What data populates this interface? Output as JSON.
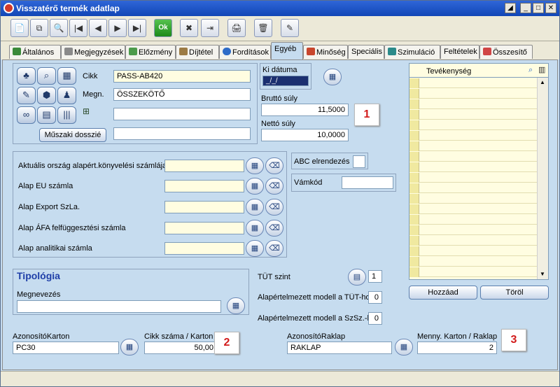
{
  "window": {
    "title": "Visszatérő termék adatlap",
    "controls": {
      "menu": "◢",
      "minimize": "_",
      "maximize": "□",
      "close": "✕"
    }
  },
  "toolbar": [
    {
      "icon": "new-icon",
      "glyph": "📄"
    },
    {
      "icon": "copy-icon",
      "glyph": "⧉"
    },
    {
      "icon": "search-icon",
      "glyph": "🔍"
    },
    {
      "icon": "first-icon",
      "glyph": "|◀"
    },
    {
      "icon": "prev-icon",
      "glyph": "◀"
    },
    {
      "icon": "next-icon",
      "glyph": "▶"
    },
    {
      "icon": "last-icon",
      "glyph": "▶|"
    },
    {
      "icon": "ok-icon",
      "glyph": "Ok"
    },
    {
      "icon": "delete-icon",
      "glyph": "✖"
    },
    {
      "icon": "exit-icon",
      "glyph": "⇥"
    },
    {
      "icon": "print-icon",
      "glyph": "🖨"
    },
    {
      "icon": "trash-icon",
      "glyph": "🗑"
    },
    {
      "icon": "tools-icon",
      "glyph": "✎"
    }
  ],
  "tabs": [
    "Általános",
    "Megjegyzések",
    "Előzmény",
    "Díjtétel",
    "Fordítások",
    "Egyéb",
    "Minőség",
    "Speciális",
    "Szimuláció",
    "Feltételek",
    "Összesítő"
  ],
  "active_tab": "Egyéb",
  "product": {
    "cikk_label": "Cikk",
    "cikk_value": "PASS-AB420",
    "megn_label": "Megn.",
    "megn_value": "ÖSSZEKÖTŐ",
    "field3_value": "",
    "field4_value": "",
    "dossier_button": "Műszaki dosszié"
  },
  "ki_datuma": {
    "label": "Ki dátuma",
    "value": "_/_/"
  },
  "weights": {
    "brutto_label": "Bruttó súly",
    "brutto_value": "11,5000",
    "netto_label": "Nettó súly",
    "netto_value": "10,0000"
  },
  "accounts": [
    {
      "label": "Aktuális ország alapért.könyvelési számlája",
      "value": ""
    },
    {
      "label": "Alap EU számla",
      "value": ""
    },
    {
      "label": "Alap Export SzLa.",
      "value": ""
    },
    {
      "label": "Alap ÁFA felfüggesztési számla",
      "value": ""
    },
    {
      "label": "Alap analitikai számla",
      "value": ""
    }
  ],
  "abc": {
    "label": "ABC elrendezés",
    "value": ""
  },
  "vamkod": {
    "label": "Vámkód",
    "value": ""
  },
  "tipologia": {
    "title": "Tipológia",
    "megnevezes_label": "Megnevezés",
    "megnevezes_value": ""
  },
  "tut": {
    "szint_label": "TÜT szint",
    "szint_value": "1",
    "modell_tut_label": "Alapértelmezett modell a TÜT-hoz",
    "modell_tut_value": "0",
    "modell_szsz_label": "Alapértelmezett modell a SzSz.-hoz",
    "modell_szsz_value": "0"
  },
  "activity": {
    "header": "Tevékenység",
    "add_button": "Hozzáad",
    "delete_button": "Töröl"
  },
  "bottom": {
    "azon_karton_label": "AzonosítóKarton",
    "azon_karton_value": "PC30",
    "cikk_szama_label": "Cikk száma / Karton",
    "cikk_szama_value": "50,00",
    "azon_raklap_label": "AzonosítóRaklap",
    "azon_raklap_value": "RAKLAP",
    "menny_label": "Menny. Karton / Raklap",
    "menny_value": "2"
  },
  "markers": [
    "1",
    "2",
    "3"
  ],
  "colors": {
    "panel": "#c6dcef",
    "field": "#fffde1",
    "title_bar": "#2f66d8",
    "marker": "#d21b1b"
  }
}
